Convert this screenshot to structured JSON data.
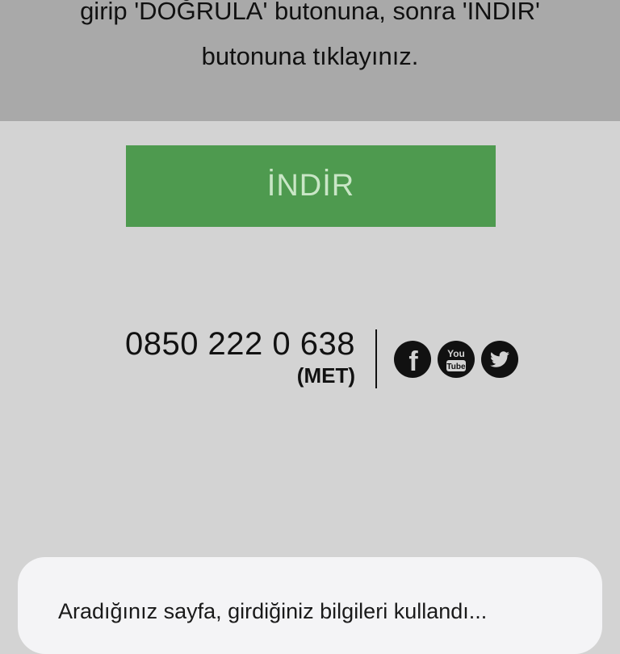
{
  "banner": {
    "line1": "girip 'DOĞRULA' butonuna, sonra 'İNDİR'",
    "line2": "butonuna tıklayınız."
  },
  "download_button": {
    "label": "İNDİR"
  },
  "contact": {
    "phone": "0850 222 0 638",
    "timezone": "(MET)"
  },
  "social": [
    {
      "icon": "facebook-icon",
      "glyph": "f"
    },
    {
      "icon": "youtube-icon",
      "glyph_top": "You",
      "glyph_bottom": "Tube"
    },
    {
      "icon": "twitter-icon"
    }
  ],
  "dialog": {
    "text": "Aradığınız sayfa, girdiğiniz bilgileri kullandı..."
  },
  "colors": {
    "banner_bg": "#a9a9a9",
    "page_bg": "#d3d3d3",
    "button_bg": "#4e9a4f",
    "button_text": "#c9e6c6"
  }
}
